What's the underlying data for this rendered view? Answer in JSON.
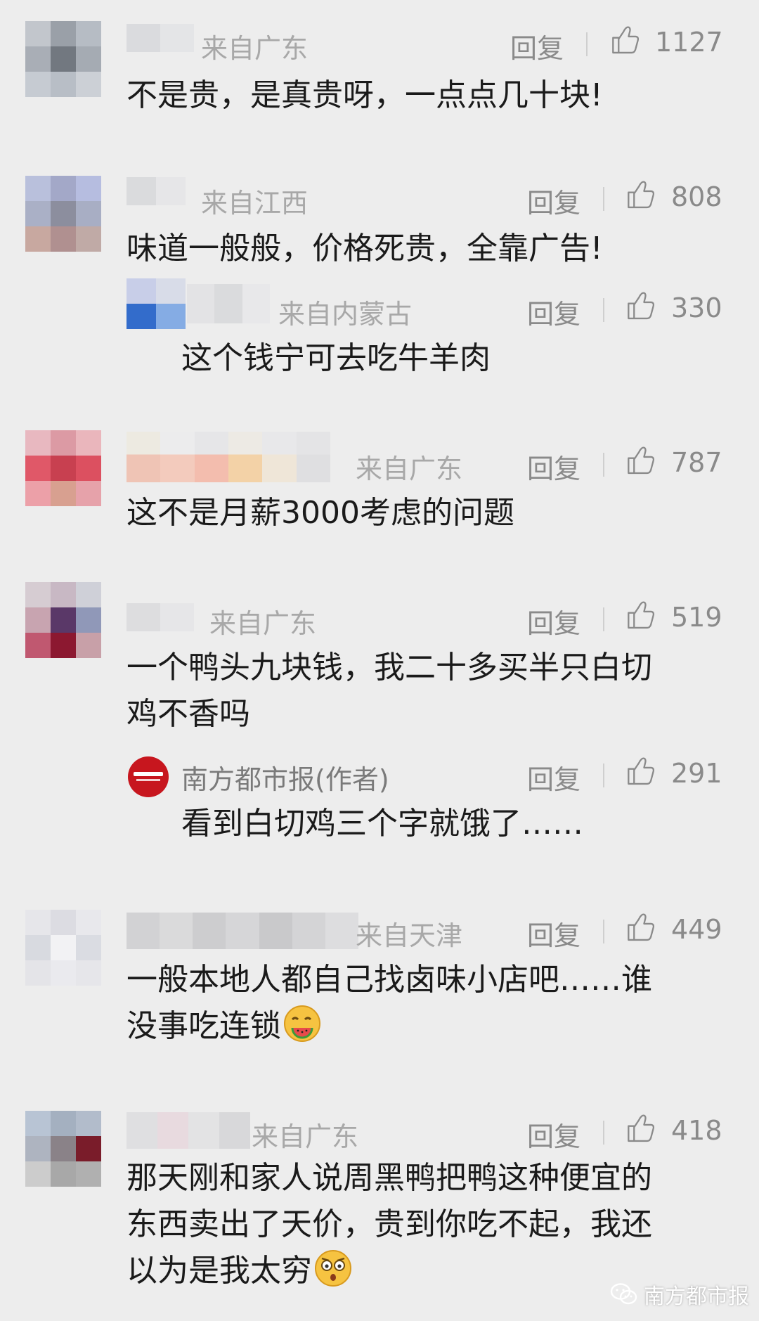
{
  "comments": [
    {
      "location": "来自广东",
      "reply": "回复",
      "likes": "1127",
      "text": "不是贵，是真贵呀，一点点几十块!"
    },
    {
      "location": "来自江西",
      "reply": "回复",
      "likes": "808",
      "text": "味道一般般，价格死贵，全靠广告!"
    },
    {
      "location": "来自内蒙古",
      "reply": "回复",
      "likes": "330",
      "text": "这个钱宁可去吃牛羊肉"
    },
    {
      "location": "来自广东",
      "reply": "回复",
      "likes": "787",
      "text": "这不是月薪3000考虑的问题"
    },
    {
      "location": "来自广东",
      "reply": "回复",
      "likes": "519",
      "text_line1": "一个鸭头九块钱，我二十多买半只白切",
      "text_line2": "鸡不香吗"
    },
    {
      "author": "南方都市报(作者)",
      "reply": "回复",
      "likes": "291",
      "text": "看到白切鸡三个字就饿了……"
    },
    {
      "location": "来自天津",
      "reply": "回复",
      "likes": "449",
      "text_line1": "一般本地人都自己找卤味小店吧……谁",
      "text_line2": "没事吃连锁"
    },
    {
      "location": "来自广东",
      "reply": "回复",
      "likes": "418",
      "text_line1": "那天刚和家人说周黑鸭把鸭这种便宜的",
      "text_line2": "东西卖出了天价，贵到你吃不起，我还",
      "text_line3": "以为是我太穷"
    }
  ],
  "watermark": "南方都市报",
  "colors": {
    "background": "#ededed",
    "meta_gray": "#8a8a8a",
    "location_gray": "#a8a8a8",
    "text": "#1a1a1a",
    "author_red": "#c7161e"
  },
  "icons": {
    "like": "thumbs-up-icon",
    "emoji_watermelon": "watermelon-emoji-icon",
    "emoji_shocked": "shocked-emoji-icon",
    "watermark_logo": "wechat-logo-icon"
  }
}
